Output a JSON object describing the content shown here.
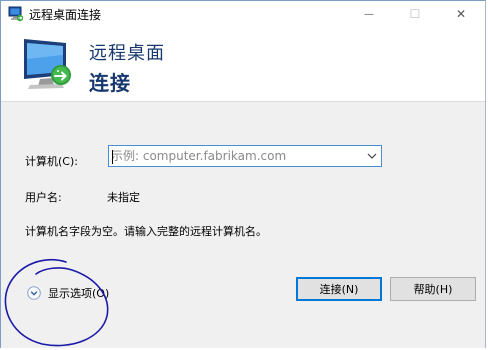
{
  "window": {
    "title": "远程桌面连接",
    "minimize_glyph": "—",
    "maximize_glyph": "☐",
    "close_glyph": "✕"
  },
  "banner": {
    "line1": "远程桌面",
    "line2": "连接"
  },
  "form": {
    "computer_label": "计算机(C):",
    "computer_placeholder": "示例: computer.fabrikam.com",
    "computer_value": "",
    "username_label": "用户名:",
    "username_value": "未指定",
    "message": "计算机名字段为空。请输入完整的远程计算机名。"
  },
  "footer": {
    "show_options": "显示选项(O)",
    "connect_button": "连接(N)",
    "help_button": "帮助(H)"
  },
  "colors": {
    "accent": "#0078d7",
    "banner_text": "#17386f",
    "scribble": "#1a1aa8"
  }
}
